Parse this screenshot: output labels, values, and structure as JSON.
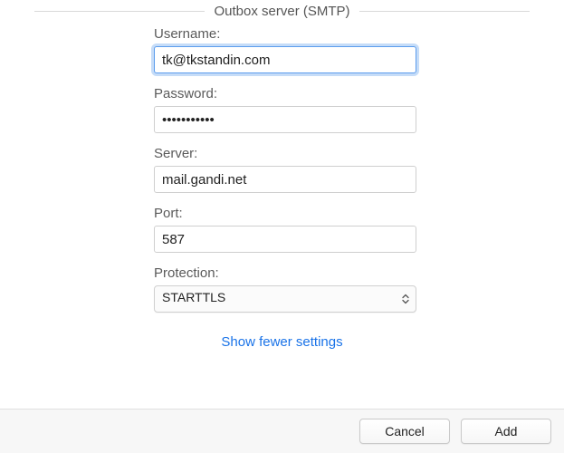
{
  "header": {
    "title": "Outbox server (SMTP)"
  },
  "form": {
    "username": {
      "label": "Username:",
      "value": "tk@tkstandin.com"
    },
    "password": {
      "label": "Password:",
      "value": "•••••••••••"
    },
    "server": {
      "label": "Server:",
      "value": "mail.gandi.net"
    },
    "port": {
      "label": "Port:",
      "value": "587"
    },
    "protection": {
      "label": "Protection:",
      "selected": "STARTTLS"
    }
  },
  "link": {
    "toggle": "Show fewer settings"
  },
  "footer": {
    "cancel": "Cancel",
    "add": "Add"
  }
}
